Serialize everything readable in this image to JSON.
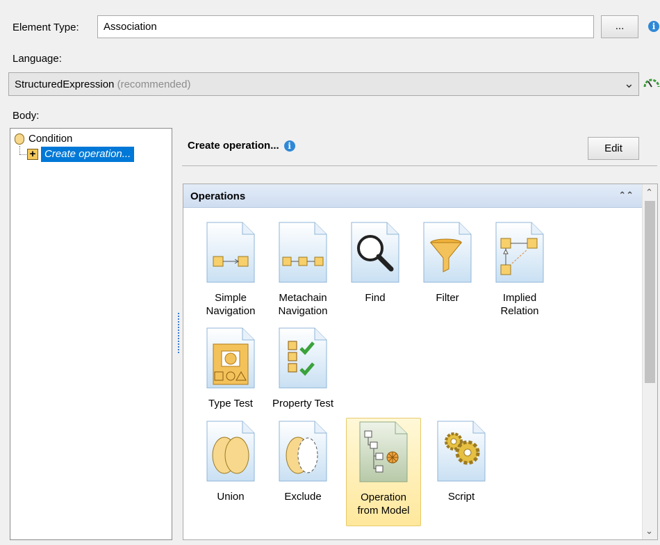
{
  "element_type": {
    "label": "Element Type:",
    "value": "Association",
    "browse_label": "..."
  },
  "language": {
    "label": "Language:",
    "selected": "StructuredExpression",
    "selected_note": "(recommended)"
  },
  "body": {
    "label": "Body:",
    "tree": {
      "root": "Condition",
      "child": "Create operation..."
    }
  },
  "operation_header": {
    "title": "Create operation...",
    "edit_label": "Edit"
  },
  "operations": {
    "title": "Operations",
    "items": [
      {
        "line1": "Simple",
        "line2": "Navigation",
        "icon": "simple-navigation-icon"
      },
      {
        "line1": "Metachain",
        "line2": "Navigation",
        "icon": "metachain-navigation-icon"
      },
      {
        "line1": "Find",
        "line2": "",
        "icon": "find-icon"
      },
      {
        "line1": "Filter",
        "line2": "",
        "icon": "filter-icon"
      },
      {
        "line1": "Implied",
        "line2": "Relation",
        "icon": "implied-relation-icon"
      },
      {
        "line1": "Type Test",
        "line2": "",
        "icon": "type-test-icon"
      },
      {
        "line1": "Property Test",
        "line2": "",
        "icon": "property-test-icon"
      },
      {
        "line1": "Union",
        "line2": "",
        "icon": "union-icon"
      },
      {
        "line1": "Exclude",
        "line2": "",
        "icon": "exclude-icon"
      },
      {
        "line1": "Operation",
        "line2": "from Model",
        "icon": "operation-from-model-icon"
      },
      {
        "line1": "Script",
        "line2": "",
        "icon": "script-icon"
      }
    ],
    "selected_item": "Operation from Model"
  },
  "colors": {
    "accent": "#0078d7",
    "info": "#2f88d6",
    "selection": "#ffe89c"
  }
}
